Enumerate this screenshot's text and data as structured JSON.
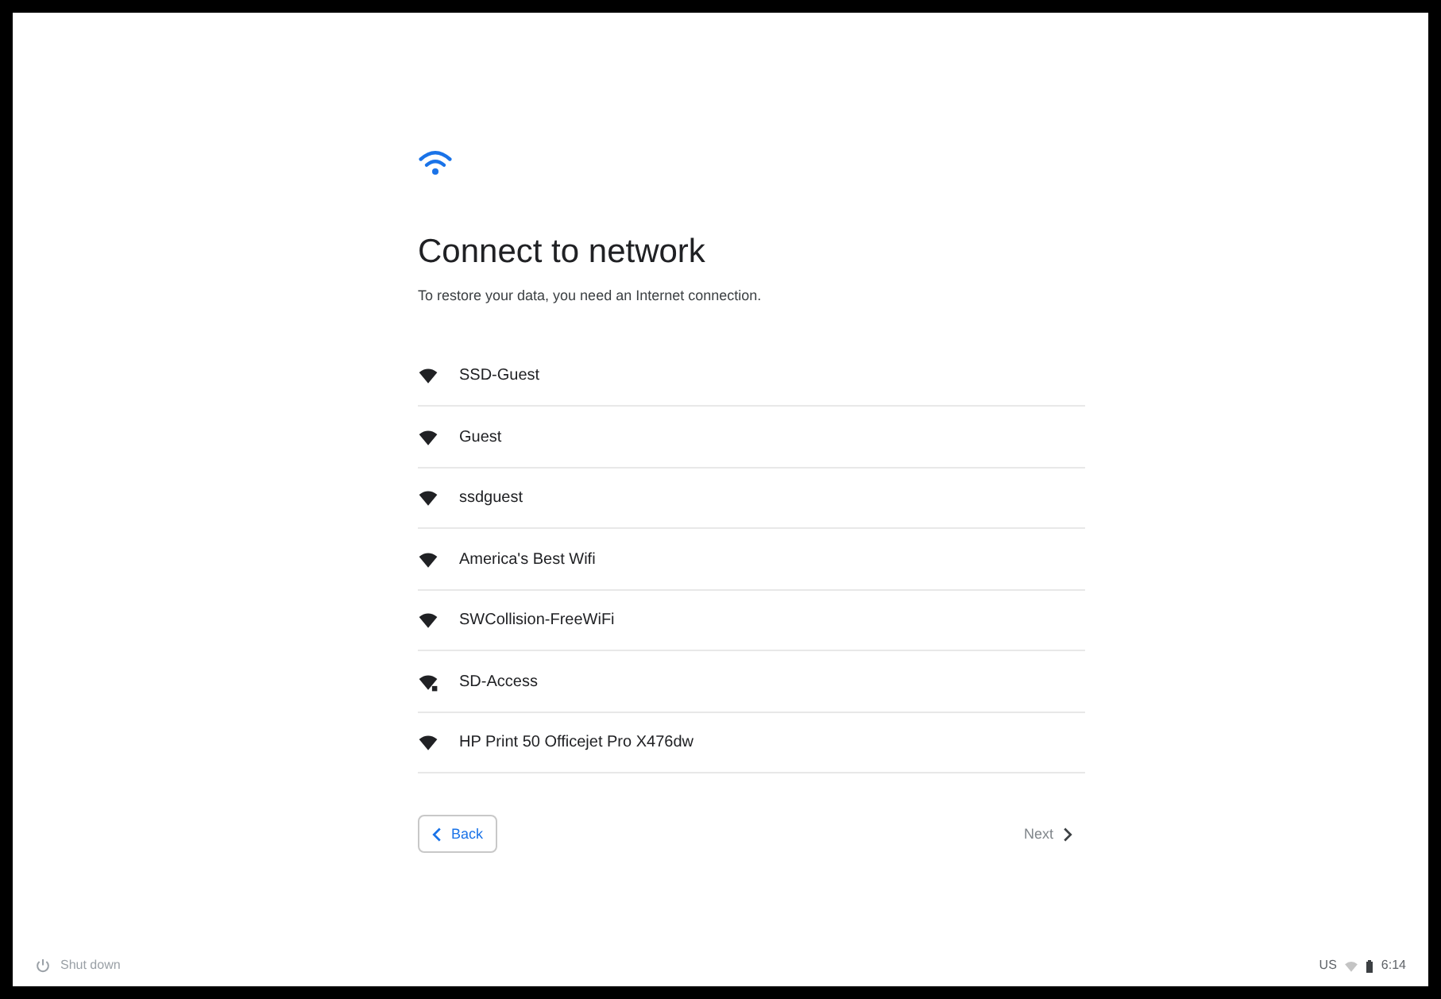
{
  "dialog": {
    "title": "Connect to network",
    "subtitle": "To restore your data, you need an Internet connection."
  },
  "networks": [
    {
      "name": "SSD-Guest",
      "secured": false
    },
    {
      "name": "Guest",
      "secured": false
    },
    {
      "name": "ssdguest",
      "secured": false
    },
    {
      "name": "America's Best Wifi",
      "secured": false
    },
    {
      "name": "SWCollision-FreeWiFi",
      "secured": false
    },
    {
      "name": "SD-Access",
      "secured": true
    },
    {
      "name": "HP Print 50 Officejet Pro X476dw",
      "secured": false
    }
  ],
  "buttons": {
    "back": "Back",
    "next": "Next"
  },
  "shelf": {
    "shutdown": "Shut down",
    "keyboard": "US",
    "time": "6:14"
  }
}
